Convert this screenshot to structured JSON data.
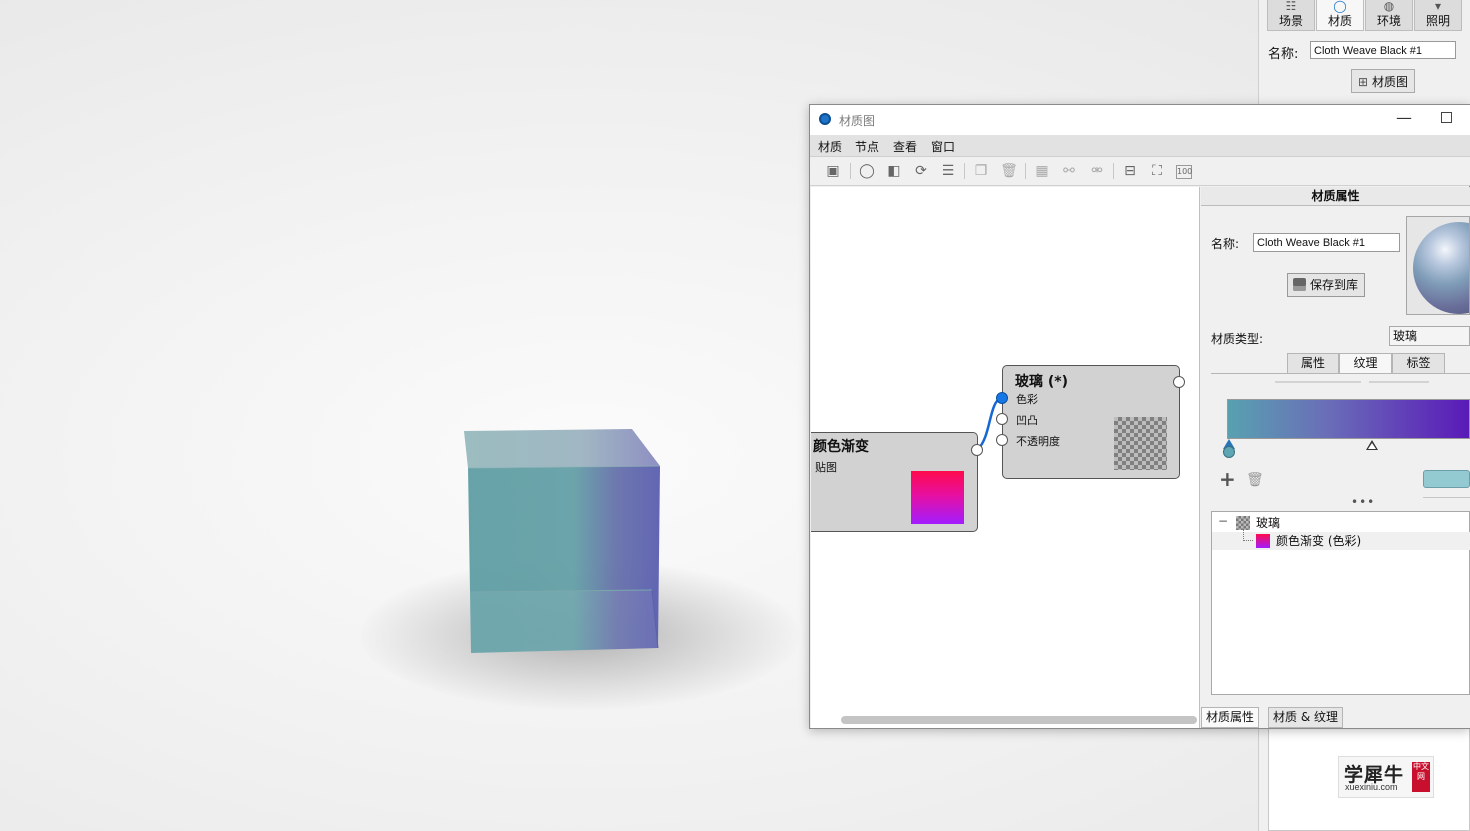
{
  "right_panel": {
    "tabs": [
      {
        "label": "场景",
        "icon": "scene-list-icon"
      },
      {
        "label": "材质",
        "icon": "material-sphere-icon"
      },
      {
        "label": "环境",
        "icon": "environment-globe-icon"
      },
      {
        "label": "照明",
        "icon": "lighting-bulb-icon"
      }
    ],
    "name_label": "名称:",
    "name_value": "Cloth Weave Black #1",
    "material_graph_button": "材质图",
    "watermark_main": "学犀牛",
    "watermark_sub": "xuexiniu.com",
    "watermark_seal": "中文网"
  },
  "window": {
    "title": "材质图",
    "menu": [
      "材质",
      "节点",
      "查看",
      "窗口"
    ],
    "toolbar_icons": [
      "save-icon",
      "material-ball-icon",
      "texture-icon",
      "render-preview-icon",
      "adjust-icon",
      "copy-icon",
      "delete-icon",
      "add-node-icon",
      "link-node-icon",
      "unlink-node-icon",
      "layout-nodes-icon",
      "fit-view-icon",
      "zoom-100-icon"
    ],
    "zoom_100_text": "100"
  },
  "graph": {
    "nodes": [
      {
        "title": "颜色渐变",
        "ports": [
          "贴图"
        ]
      },
      {
        "title": "玻璃 (*)",
        "ports": [
          "色彩",
          "凹凸",
          "不透明度"
        ]
      }
    ]
  },
  "props": {
    "header": "材质属性",
    "name_label": "名称:",
    "name_value": "Cloth Weave Black #1",
    "save_button": "保存到库",
    "material_type_label": "材质类型:",
    "material_type_value": "玻璃",
    "tabs": [
      "属性",
      "纹理",
      "标签"
    ],
    "active_tab": "纹理",
    "gradient": {
      "start_color": "#58a1b0",
      "end_color": "#5a1ab8",
      "stops": [
        0.0,
        0.59
      ]
    },
    "ellipsis": "•••",
    "tree": [
      {
        "label": "玻璃",
        "expander": "−"
      },
      {
        "label": "颜色渐变 (色彩)"
      }
    ],
    "bottom_tabs": [
      "材质属性",
      "材质 & 纹理"
    ]
  }
}
